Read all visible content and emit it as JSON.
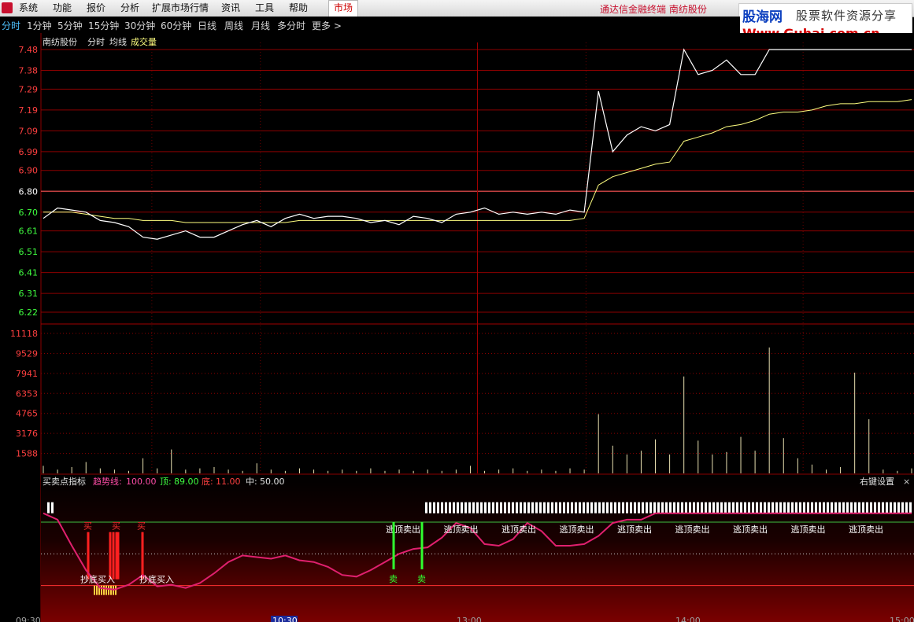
{
  "menu": {
    "items": [
      "系统",
      "功能",
      "报价",
      "分析",
      "扩展市场行情",
      "资讯",
      "工具",
      "帮助"
    ],
    "market_tab": "市场",
    "app_title": "通达信金融终端  南纺股份"
  },
  "watermark": {
    "site_cn": "股海网",
    "slogan": "股票软件资源分享",
    "url": "Www.Guhai.com.cn"
  },
  "periods": {
    "items": [
      "分时",
      "1分钟",
      "5分钟",
      "15分钟",
      "30分钟",
      "60分钟",
      "日线",
      "周线",
      "月线",
      "多分时",
      "更多 >"
    ],
    "active": "分时"
  },
  "price_panel": {
    "stock_name": "南纺股份",
    "label_mode": "分时",
    "label_avg": "均线",
    "label_vol": "成交量",
    "ticks": [
      "7.48",
      "7.38",
      "7.29",
      "7.19",
      "7.09",
      "6.99",
      "6.90",
      "6.80",
      "6.70",
      "6.61",
      "6.51",
      "6.41",
      "6.31",
      "6.22"
    ],
    "ref_price": "6.80",
    "colors": {
      "up": "#ff4040",
      "ref": "#ffffff",
      "down": "#40ff40",
      "grid": "#8b0000",
      "price_line": "#ffffff",
      "avg_line": "#ffff80"
    }
  },
  "volume_panel": {
    "ticks": [
      "11118",
      "9529",
      "7941",
      "6353",
      "4765",
      "3176",
      "1588"
    ]
  },
  "indicator_panel": {
    "name": "买卖点指标",
    "trend_label": "趋势线:",
    "trend_value": "100.00",
    "top_label": "顶:",
    "top_value": "89.00",
    "bottom_label": "底:",
    "bottom_value": "11.00",
    "mid_label": "中:",
    "mid_value": "50.00",
    "settings_button": "右键设置",
    "close_glyph": "×",
    "buy_label": "买",
    "sell_label": "卖",
    "bottom_buy_label": "抄底买入",
    "top_sell_label": "逃顶卖出"
  },
  "time_axis": {
    "labels": [
      "09:30",
      "10:30",
      "13:00",
      "14:00",
      "15:00"
    ],
    "cursor": "10:30"
  },
  "chart_data": {
    "type": "line",
    "title": "南纺股份 分时",
    "ylim": [
      6.22,
      7.48
    ],
    "price": [
      6.67,
      6.72,
      6.71,
      6.7,
      6.66,
      6.65,
      6.63,
      6.58,
      6.57,
      6.59,
      6.61,
      6.58,
      6.58,
      6.61,
      6.64,
      6.66,
      6.63,
      6.67,
      6.69,
      6.67,
      6.68,
      6.68,
      6.67,
      6.65,
      6.66,
      6.64,
      6.68,
      6.67,
      6.65,
      6.69,
      6.7,
      6.72,
      6.69,
      6.7,
      6.69,
      6.7,
      6.69,
      6.71,
      6.7,
      7.28,
      6.99,
      7.07,
      7.11,
      7.09,
      7.12,
      7.48,
      7.36,
      7.38,
      7.43,
      7.36,
      7.36,
      7.48,
      7.48,
      7.48,
      7.48,
      7.48,
      7.48,
      7.48,
      7.48,
      7.48,
      7.48,
      7.48
    ],
    "avg": [
      6.7,
      6.7,
      6.7,
      6.69,
      6.68,
      6.67,
      6.67,
      6.66,
      6.66,
      6.66,
      6.65,
      6.65,
      6.65,
      6.65,
      6.65,
      6.65,
      6.65,
      6.65,
      6.66,
      6.66,
      6.66,
      6.66,
      6.66,
      6.66,
      6.66,
      6.66,
      6.66,
      6.66,
      6.66,
      6.66,
      6.66,
      6.66,
      6.66,
      6.66,
      6.66,
      6.66,
      6.66,
      6.66,
      6.67,
      6.83,
      6.87,
      6.89,
      6.91,
      6.93,
      6.94,
      7.04,
      7.06,
      7.08,
      7.11,
      7.12,
      7.14,
      7.17,
      7.18,
      7.18,
      7.19,
      7.21,
      7.22,
      7.22,
      7.23,
      7.23,
      7.23,
      7.24
    ],
    "volume": [
      600,
      300,
      500,
      900,
      400,
      300,
      200,
      1200,
      400,
      1900,
      300,
      400,
      500,
      300,
      200,
      800,
      300,
      200,
      400,
      300,
      200,
      300,
      200,
      400,
      200,
      300,
      200,
      300,
      200,
      300,
      600,
      200,
      300,
      400,
      200,
      300,
      200,
      400,
      300,
      4700,
      2200,
      1500,
      1800,
      2700,
      1500,
      7700,
      2600,
      1500,
      1700,
      2900,
      1800,
      10000,
      2800,
      1200,
      700,
      300,
      500,
      8000,
      4300,
      300,
      200,
      400
    ],
    "indicator": {
      "trend": [
        100,
        92,
        60,
        30,
        8,
        6,
        12,
        24,
        10,
        12,
        8,
        14,
        26,
        40,
        48,
        46,
        44,
        48,
        42,
        40,
        34,
        24,
        22,
        30,
        40,
        50,
        56,
        58,
        70,
        88,
        82,
        62,
        60,
        68,
        88,
        78,
        60,
        60,
        62,
        72,
        88,
        92,
        92,
        100,
        100,
        100,
        100,
        100,
        100,
        100,
        100,
        100,
        100,
        100,
        100,
        100,
        100,
        100,
        100,
        100,
        100,
        100
      ],
      "top": 89,
      "bottom": 11,
      "mid": 50
    }
  }
}
